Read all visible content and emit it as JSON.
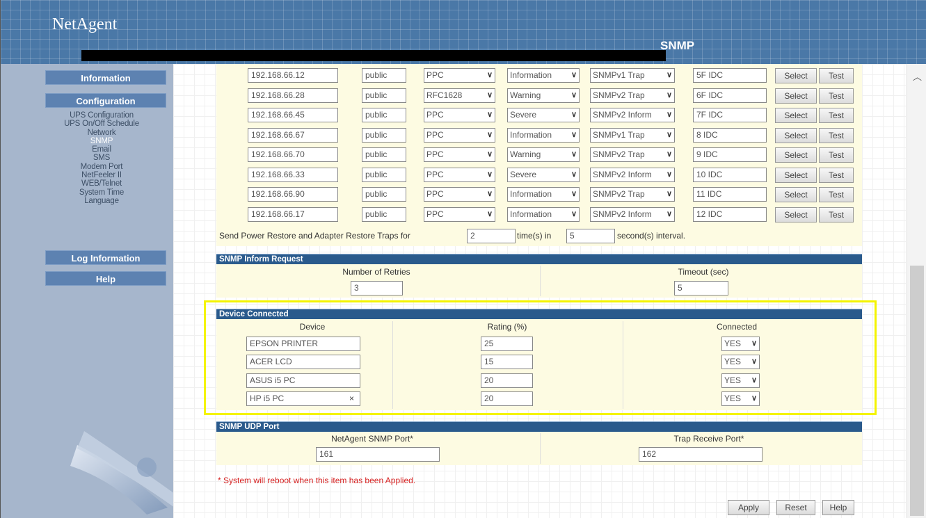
{
  "app": {
    "logo": "NetAgent",
    "page_title": "SNMP"
  },
  "sidebar": {
    "sections": [
      {
        "label": "Information"
      },
      {
        "label": "Configuration"
      },
      {
        "label": "Log Information"
      },
      {
        "label": "Help"
      }
    ],
    "config_items": [
      {
        "label": "UPS Configuration",
        "active": false
      },
      {
        "label": "UPS On/Off Schedule",
        "active": false
      },
      {
        "label": "Network",
        "active": false
      },
      {
        "label": "SNMP",
        "active": true
      },
      {
        "label": "Email",
        "active": false
      },
      {
        "label": "SMS",
        "active": false
      },
      {
        "label": "Modem Port",
        "active": false
      },
      {
        "label": "NetFeeler II",
        "active": false
      },
      {
        "label": "WEB/Telnet",
        "active": false
      },
      {
        "label": "System Time",
        "active": false
      },
      {
        "label": "Language",
        "active": false
      }
    ]
  },
  "trap_table": {
    "rows": [
      {
        "ip": "192.168.66.12",
        "community": "public",
        "trap_type": "PPC",
        "severity": "Information",
        "accept": "SNMPv1 Trap",
        "description": "5F IDC",
        "select": "Select",
        "test": "Test"
      },
      {
        "ip": "192.168.66.28",
        "community": "public",
        "trap_type": "RFC1628",
        "severity": "Warning",
        "accept": "SNMPv2 Trap",
        "description": "6F IDC",
        "select": "Select",
        "test": "Test"
      },
      {
        "ip": "192.168.66.45",
        "community": "public",
        "trap_type": "PPC",
        "severity": "Severe",
        "accept": "SNMPv2 Inform",
        "description": "7F IDC",
        "select": "Select",
        "test": "Test"
      },
      {
        "ip": "192.168.66.67",
        "community": "public",
        "trap_type": "PPC",
        "severity": "Information",
        "accept": "SNMPv1 Trap",
        "description": "8  IDC",
        "select": "Select",
        "test": "Test"
      },
      {
        "ip": "192.168.66.70",
        "community": "public",
        "trap_type": "PPC",
        "severity": "Warning",
        "accept": "SNMPv2 Trap",
        "description": "9  IDC",
        "select": "Select",
        "test": "Test"
      },
      {
        "ip": "192.168.66.33",
        "community": "public",
        "trap_type": "PPC",
        "severity": "Severe",
        "accept": "SNMPv2 Inform",
        "description": "10 IDC",
        "select": "Select",
        "test": "Test"
      },
      {
        "ip": "192.168.66.90",
        "community": "public",
        "trap_type": "PPC",
        "severity": "Information",
        "accept": "SNMPv2 Trap",
        "description": "11 IDC",
        "select": "Select",
        "test": "Test"
      },
      {
        "ip": "192.168.66.17",
        "community": "public",
        "trap_type": "PPC",
        "severity": "Information",
        "accept": "SNMPv2 Inform",
        "description": "12 IDC",
        "select": "Select",
        "test": "Test"
      }
    ]
  },
  "restore_traps": {
    "label_before": "Send Power Restore and Adapter Restore Traps for",
    "times_value": "2",
    "label_middle": "time(s) in",
    "interval_value": "5",
    "label_after": "second(s) interval."
  },
  "inform_request": {
    "title": "SNMP Inform Request",
    "retries_label": "Number of Retries",
    "retries_value": "3",
    "timeout_label": "Timeout (sec)",
    "timeout_value": "5"
  },
  "device_connected": {
    "title": "Device Connected",
    "col_device": "Device",
    "col_rating": "Rating (%)",
    "col_connected": "Connected",
    "clear_glyph": "×",
    "rows": [
      {
        "device": "EPSON PRINTER",
        "rating": "25",
        "connected": "YES"
      },
      {
        "device": "ACER LCD",
        "rating": "15",
        "connected": "YES"
      },
      {
        "device": "ASUS i5 PC",
        "rating": "20",
        "connected": "YES"
      },
      {
        "device": "HP i5  PC",
        "rating": "20",
        "connected": "YES"
      }
    ]
  },
  "udp_port": {
    "title": "SNMP UDP Port",
    "snmp_port_label": "NetAgent SNMP Port*",
    "snmp_port_value": "161",
    "trap_port_label": "Trap Receive Port*",
    "trap_port_value": "162"
  },
  "note": "*  System will reboot when this item has been Applied.",
  "actions": {
    "apply": "Apply",
    "reset": "Reset",
    "help": "Help"
  },
  "colors": {
    "header_blue": "#4a78a7",
    "section_bar": "#2a5a8c",
    "panel_bg": "#fdfbe2",
    "sidebar_bg": "#a6b6cc",
    "highlight": "#f4f400",
    "note_red": "#d62222"
  },
  "icons": {
    "dropdown": "chevron-down-icon",
    "scroll_up": "scroll-up-icon",
    "clear": "clear-x-icon"
  }
}
